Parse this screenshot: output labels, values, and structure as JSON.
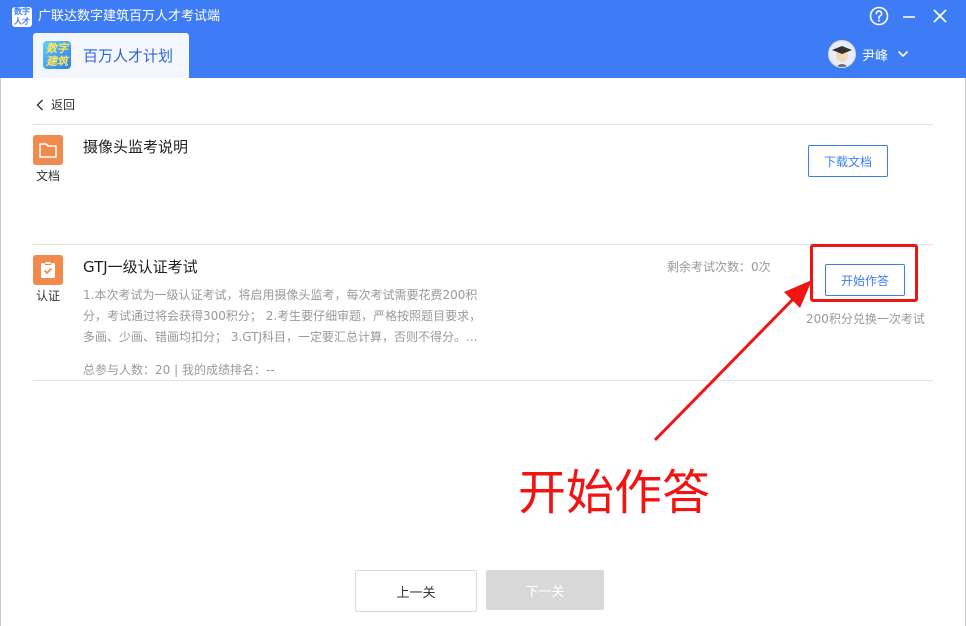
{
  "window": {
    "logo_text": "数字人才",
    "title": "广联达数字建筑百万人才考试端",
    "help_icon": "help-circle-icon",
    "minimize_icon": "minimize-icon",
    "close_icon": "close-icon"
  },
  "tab": {
    "logo_text_line1": "数字",
    "logo_text_line2": "建筑",
    "label": "百万人才计划"
  },
  "user": {
    "name": "尹峰",
    "avatar_icon": "graduate-avatar-icon"
  },
  "nav": {
    "back_label": "返回"
  },
  "items": [
    {
      "icon": "folder-icon",
      "caption": "文档",
      "title": "摄像头监考说明",
      "button_label": "下载文档"
    },
    {
      "icon": "certificate-check-icon",
      "caption": "认证",
      "title": "GTJ一级认证考试",
      "remaining": "剩余考试次数：0次",
      "description": "1.本次考试为一级认证考试，将启用摄像头监考，每次考试需要花费200积分，考试通过将会获得300积分； 2.考生要仔细审题，严格按照题目要求，多画、少画、错画均扣分； 3.GTJ科目，一定要汇总计算，否则不得分。...",
      "stats": "总参与人数：20 | 我的成绩排名：--",
      "button_label": "开始作答",
      "note": "200积分兑换一次考试"
    }
  ],
  "annotation": {
    "text": "开始作答",
    "color": "#f21313"
  },
  "footer": {
    "prev_label": "上一关",
    "next_label": "下一关"
  },
  "colors": {
    "header": "#3d7cf4",
    "accent": "#3d7cf4",
    "icon_orange": "#f2894d"
  }
}
